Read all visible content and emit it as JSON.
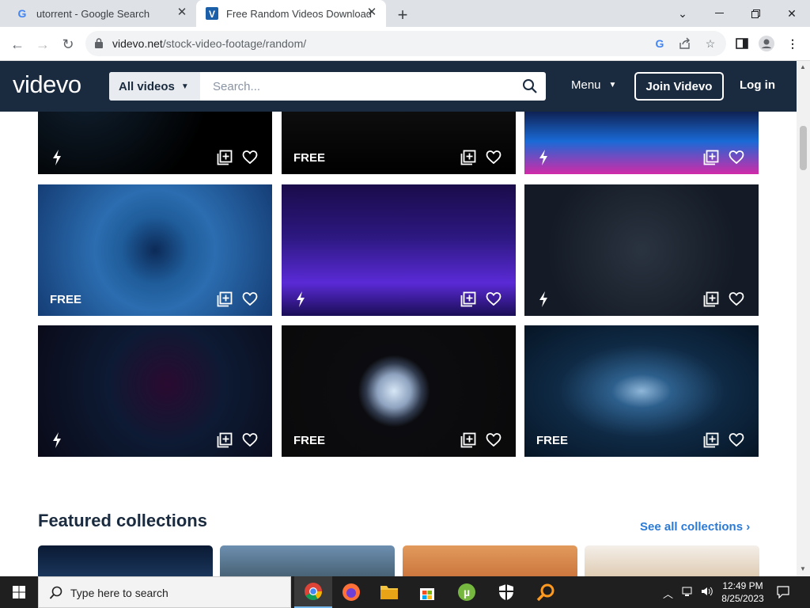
{
  "browser": {
    "tabs": [
      {
        "title": "utorrent - Google Search",
        "favicon": "google-icon"
      },
      {
        "title": "Free Random Videos Download",
        "favicon": "videvo-icon",
        "active": true
      }
    ],
    "address": {
      "domain": "videvo.net",
      "path": "/stock-video-footage/random/"
    }
  },
  "site": {
    "logo": "videvo",
    "search_category": "All videos",
    "search_placeholder": "Search...",
    "menu_label": "Menu",
    "join_label": "Join Videvo",
    "login_label": "Log in"
  },
  "videos": [
    {
      "badge": "",
      "type": "premium",
      "theme": "neon-stars"
    },
    {
      "badge": "FREE",
      "type": "free",
      "theme": "particles"
    },
    {
      "badge": "",
      "type": "premium",
      "theme": "retro-grid"
    },
    {
      "badge": "FREE",
      "type": "free",
      "theme": "blue-tunnel"
    },
    {
      "badge": "",
      "type": "premium",
      "theme": "neon-triangle"
    },
    {
      "badge": "",
      "type": "premium",
      "theme": "lightning"
    },
    {
      "badge": "",
      "type": "premium",
      "theme": "star-tunnel"
    },
    {
      "badge": "FREE",
      "type": "free",
      "theme": "plasma-sphere"
    },
    {
      "badge": "FREE",
      "type": "free",
      "theme": "blue-rays"
    }
  ],
  "featured": {
    "title": "Featured collections",
    "see_all": "See all collections"
  },
  "taskbar": {
    "search_label": "Type here to search",
    "time": "12:49 PM",
    "date": "8/25/2023"
  },
  "colors": {
    "header_bg": "#1b2b3f",
    "link": "#2a7ad6",
    "taskbar": "#1f1f1f"
  }
}
